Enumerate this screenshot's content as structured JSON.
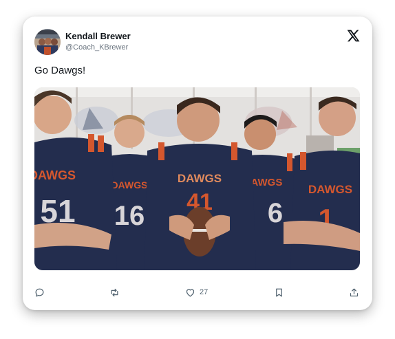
{
  "author": {
    "name": "Kendall Brewer",
    "handle": "@Coach_KBrewer"
  },
  "tweet": {
    "text": "Go Dawgs!"
  },
  "media": {
    "jersey_text": "DAWGS",
    "jersey_numbers": [
      "51",
      "16",
      "41",
      "6",
      "1"
    ]
  },
  "actions": {
    "reply_count": "",
    "retweet_count": "",
    "like_count": "27",
    "bookmark_count": "",
    "share_count": ""
  },
  "colors": {
    "text_primary": "#0f1419",
    "text_secondary": "#536471",
    "jersey_navy": "#232d4e",
    "jersey_orange": "#d4572e"
  },
  "icons": {
    "brand": "x-logo-icon",
    "reply": "reply-icon",
    "retweet": "retweet-icon",
    "like": "heart-icon",
    "bookmark": "bookmark-icon",
    "share": "share-icon"
  }
}
